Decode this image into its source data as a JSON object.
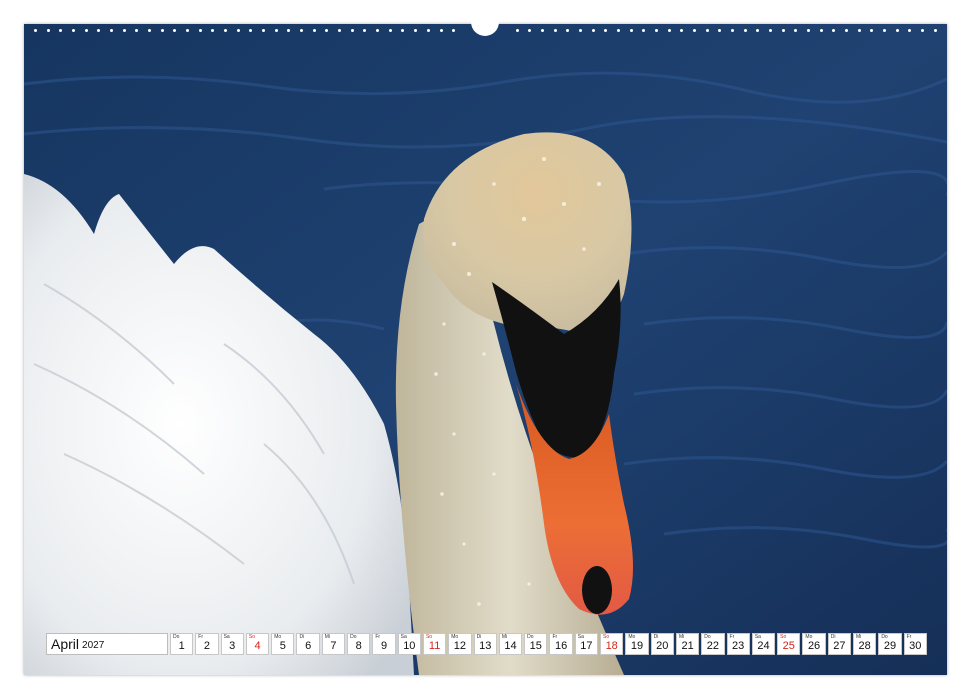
{
  "calendar": {
    "month": "April",
    "year": "2027",
    "days": [
      {
        "num": "1",
        "dow": "Do",
        "sunday": false
      },
      {
        "num": "2",
        "dow": "Fr",
        "sunday": false
      },
      {
        "num": "3",
        "dow": "Sa",
        "sunday": false
      },
      {
        "num": "4",
        "dow": "So",
        "sunday": true
      },
      {
        "num": "5",
        "dow": "Mo",
        "sunday": false
      },
      {
        "num": "6",
        "dow": "Di",
        "sunday": false
      },
      {
        "num": "7",
        "dow": "Mi",
        "sunday": false
      },
      {
        "num": "8",
        "dow": "Do",
        "sunday": false
      },
      {
        "num": "9",
        "dow": "Fr",
        "sunday": false
      },
      {
        "num": "10",
        "dow": "Sa",
        "sunday": false
      },
      {
        "num": "11",
        "dow": "So",
        "sunday": true
      },
      {
        "num": "12",
        "dow": "Mo",
        "sunday": false
      },
      {
        "num": "13",
        "dow": "Di",
        "sunday": false
      },
      {
        "num": "14",
        "dow": "Mi",
        "sunday": false
      },
      {
        "num": "15",
        "dow": "Do",
        "sunday": false
      },
      {
        "num": "16",
        "dow": "Fr",
        "sunday": false
      },
      {
        "num": "17",
        "dow": "Sa",
        "sunday": false
      },
      {
        "num": "18",
        "dow": "So",
        "sunday": true
      },
      {
        "num": "19",
        "dow": "Mo",
        "sunday": false
      },
      {
        "num": "20",
        "dow": "Di",
        "sunday": false
      },
      {
        "num": "21",
        "dow": "Mi",
        "sunday": false
      },
      {
        "num": "22",
        "dow": "Do",
        "sunday": false
      },
      {
        "num": "23",
        "dow": "Fr",
        "sunday": false
      },
      {
        "num": "24",
        "dow": "Sa",
        "sunday": false
      },
      {
        "num": "25",
        "dow": "So",
        "sunday": true
      },
      {
        "num": "26",
        "dow": "Mo",
        "sunday": false
      },
      {
        "num": "27",
        "dow": "Di",
        "sunday": false
      },
      {
        "num": "28",
        "dow": "Mi",
        "sunday": false
      },
      {
        "num": "29",
        "dow": "Do",
        "sunday": false
      },
      {
        "num": "30",
        "dow": "Fr",
        "sunday": false
      }
    ]
  },
  "colors": {
    "water": "#1d3c6a",
    "sunday": "#d4261d",
    "beak": "#e8642a"
  },
  "photo_subject_icons": [
    "swan-head-illustration",
    "swan-wing-illustration"
  ]
}
